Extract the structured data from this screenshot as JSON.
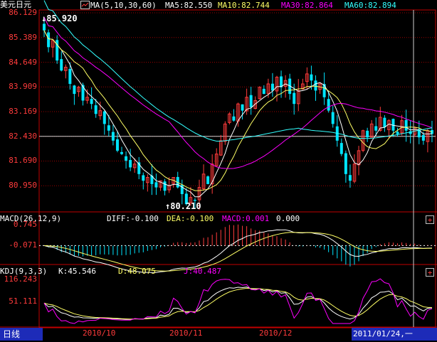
{
  "instrument": "美元日元",
  "main_indicator": {
    "label": "MA(5,10,30,60)",
    "ma5": "MA5:82.550",
    "ma10": "MA10:82.744",
    "ma30": "MA30:82.864",
    "ma60": "MA60:82.894"
  },
  "price_axis": [
    "86.129",
    "85.389",
    "84.649",
    "83.909",
    "83.169",
    "82.430",
    "81.690",
    "80.950"
  ],
  "high_label": "85.920",
  "low_label": "80.210",
  "macd": {
    "label": "MACD(26,12,9)",
    "diff": "DIFF:-0.100",
    "dea": "DEA:-0.100",
    "macd": "MACD:0.001",
    "extra": "0.000",
    "axis": [
      "0.745",
      "-0.071"
    ]
  },
  "kdj": {
    "label": "KDJ(9,3,3)",
    "k": "K:45.546",
    "d": "D:48.075",
    "j": "J:40.487",
    "axis": [
      "116.243",
      "51.111"
    ]
  },
  "date_labels": [
    "2010/10",
    "2010/11",
    "2010/12"
  ],
  "period": "日线",
  "cursor_date": "2011/01/24,一",
  "plus_button": "+",
  "colors": {
    "up": "#ff3b3b",
    "down": "#00e5ff",
    "ma5": "#ffffff",
    "ma10": "#ffff66",
    "ma30": "#ff00ff",
    "ma60": "#33ffff",
    "grid": "#9a0000",
    "frame": "#c00000"
  },
  "chart_data": {
    "type": "candlestick",
    "price_ylim": [
      80.21,
      86.129
    ],
    "closes": [
      85.6,
      85.1,
      85.3,
      84.7,
      84.4,
      84.5,
      84.0,
      83.7,
      83.9,
      83.5,
      83.6,
      83.4,
      83.1,
      83.2,
      82.8,
      82.6,
      82.3,
      82.0,
      81.9,
      81.7,
      81.5,
      81.6,
      81.3,
      81.1,
      81.2,
      81.0,
      80.9,
      81.1,
      80.8,
      80.95,
      81.2,
      80.9,
      80.7,
      80.4,
      80.6,
      80.5,
      80.9,
      81.3,
      81.0,
      81.6,
      81.9,
      82.3,
      82.8,
      83.1,
      82.9,
      83.4,
      83.2,
      83.6,
      83.3,
      83.5,
      83.9,
      83.7,
      84.0,
      83.8,
      84.2,
      83.9,
      84.1,
      83.7,
      83.4,
      83.8,
      84.0,
      84.3,
      84.1,
      83.8,
      84.0,
      83.6,
      83.2,
      82.8,
      82.3,
      81.9,
      81.3,
      81.1,
      81.6,
      82.0,
      82.6,
      82.4,
      82.8,
      82.6,
      83.0,
      82.7,
      82.9,
      82.6,
      82.5,
      82.9,
      82.6,
      82.5,
      82.7,
      82.4,
      82.3,
      82.6,
      82.5
    ],
    "kdj_ylim": [
      0,
      116.243
    ],
    "macd_ylim": [
      -0.6,
      0.8
    ]
  }
}
